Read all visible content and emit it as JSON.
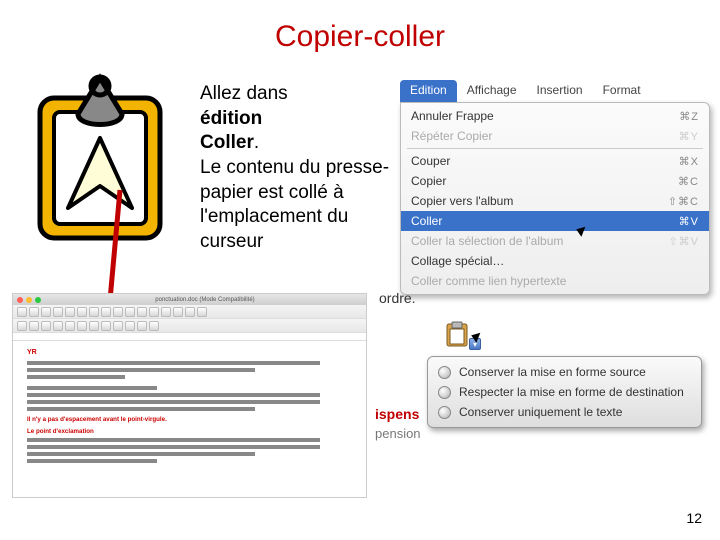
{
  "title": "Copier-coller",
  "body": {
    "p1": "Allez dans",
    "p2_bold": "édition",
    "p3_bold": "Coller",
    "p3_dot": ".",
    "p4": "Le contenu du presse-papier est collé à l'emplacement du curseur"
  },
  "menubar": {
    "edition": "Edition",
    "affichage": "Affichage",
    "insertion": "Insertion",
    "format": "Format"
  },
  "menu": {
    "undo": {
      "label": "Annuler Frappe",
      "sc": "⌘Z"
    },
    "redo": {
      "label": "Répéter Copier",
      "sc": "⌘Y"
    },
    "cut": {
      "label": "Couper",
      "sc": "⌘X"
    },
    "copy": {
      "label": "Copier",
      "sc": "⌘C"
    },
    "copyalbum": {
      "label": "Copier vers l'album",
      "sc": "⇧⌘C"
    },
    "paste": {
      "label": "Coller",
      "sc": "⌘V"
    },
    "pastealbum": {
      "label": "Coller la sélection de l'album",
      "sc": "⇧⌘V"
    },
    "pastespecial": {
      "label": "Collage spécial…",
      "sc": ""
    },
    "pastelink": {
      "label": "Coller comme lien hypertexte",
      "sc": ""
    }
  },
  "doc": {
    "titlebar": "ponctuation.doc (Mode Compatibilité)",
    "red1": "Il n'y a pas d'espacement avant le point-virgule.",
    "red2": "Le point d'exclamation"
  },
  "popup_area": {
    "ordre": "ordre.",
    "opt1": "Conserver la mise en forme source",
    "opt2": "Respecter la mise en forme de destination",
    "opt3": "Conserver uniquement le texte",
    "red_frag": "ispens",
    "grey_frag": "pension"
  },
  "page_number": "12"
}
